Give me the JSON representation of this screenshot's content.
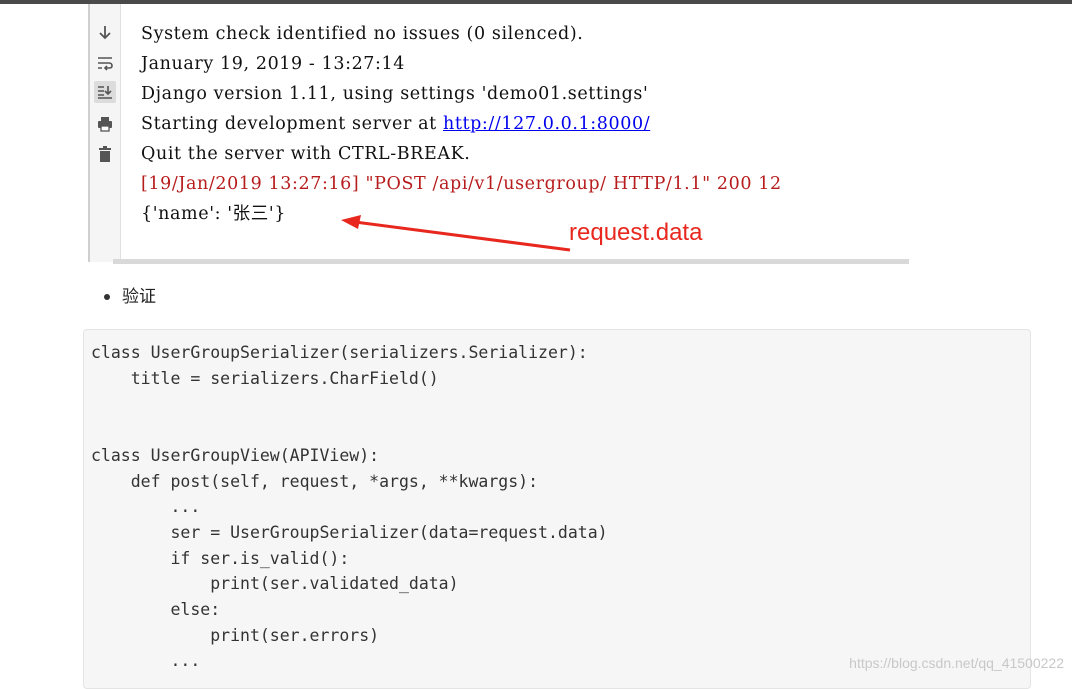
{
  "console": {
    "lines": [
      "System check identified no issues (0 silenced).",
      "January 19, 2019 - 13:27:14",
      "Django version 1.11, using settings 'demo01.settings'",
      "Starting development server at ",
      "Quit the server with CTRL-BREAK.",
      "[19/Jan/2019 13:27:16] \"POST /api/v1/usergroup/ HTTP/1.1\" 200 12",
      "{'name': '张三'}"
    ],
    "server_url": "http://127.0.0.1:8000/",
    "annotation": "request.data",
    "toolbar_icons": [
      "arrow-down-icon",
      "soft-wrap-icon",
      "scroll-to-end-icon",
      "print-icon",
      "trash-icon"
    ],
    "error_color": "#b71c1c",
    "annotation_color": "#e8281e"
  },
  "bullet": {
    "text": "验证"
  },
  "code": {
    "text": "class UserGroupSerializer(serializers.Serializer):\n    title = serializers.CharField()\n\n\nclass UserGroupView(APIView):\n    def post(self, request, *args, **kwargs):\n        ...\n        ser = UserGroupSerializer(data=request.data)\n        if ser.is_valid():\n            print(ser.validated_data)\n        else:\n            print(ser.errors)\n        ..."
  },
  "watermark": "https://blog.csdn.net/qq_41500222"
}
